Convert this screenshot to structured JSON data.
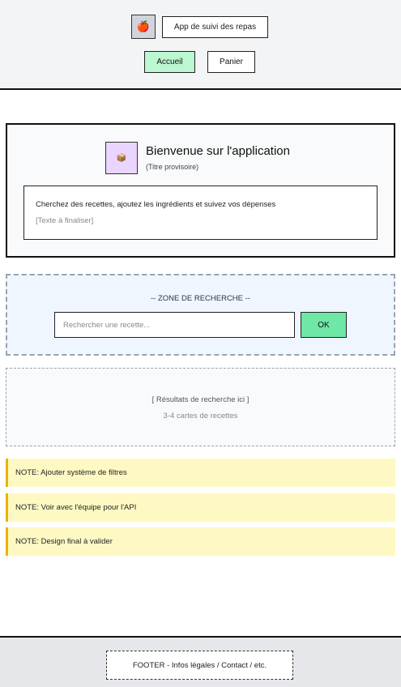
{
  "header": {
    "logo_icon": "🍎",
    "app_title": "App de suivi des repas",
    "nav": {
      "home_label": "Accueil",
      "cart_label": "Panier"
    }
  },
  "welcome": {
    "icon": "📦",
    "title": "Bienvenue sur l'application",
    "subtitle": "(Titre provisoire)",
    "description": "Cherchez des recettes, ajoutez les ingrédients et suivez vos dépenses",
    "description_note": "[Texte à finaliser]"
  },
  "search": {
    "label": "-- ZONE DE RECHERCHE --",
    "placeholder": "Rechercher une recette...",
    "button_label": "OK"
  },
  "results": {
    "title": "[ Résultats de recherche ici ]",
    "subtitle": "3-4 cartes de recettes"
  },
  "notes": [
    "NOTE: Ajouter système de filtres",
    "NOTE: Voir avec l'équipe pour l'API",
    "NOTE: Design final à valider"
  ],
  "footer": {
    "text": "FOOTER - Infos légales / Contact / etc."
  },
  "colors": {
    "header_bg": "#f3f4f6",
    "home_button": "#bbf7d0",
    "welcome_icon_bg": "#e9d5ff",
    "search_bg": "#eff6ff",
    "ok_button": "#6ee7a7",
    "note_bg": "#fef9c3",
    "note_accent": "#eab308",
    "footer_bg": "#e5e7eb"
  }
}
